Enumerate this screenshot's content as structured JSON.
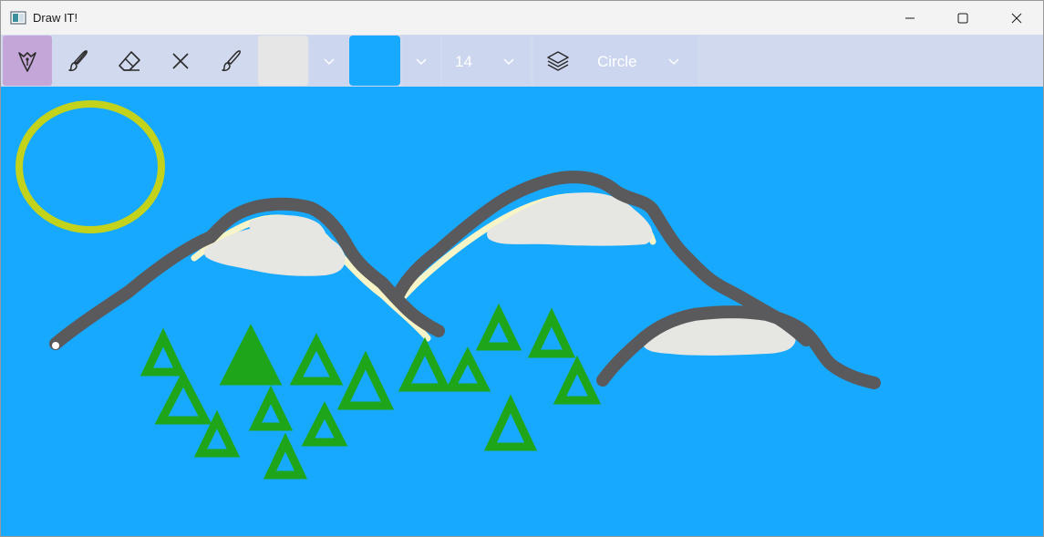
{
  "window": {
    "title": "Draw IT!"
  },
  "toolbar": {
    "stroke_color": "#e6e6e6",
    "fill_color": "#17a9fe",
    "stroke_size": "14",
    "shape": "Circle",
    "active_tool": "pen-tool"
  },
  "canvas": {
    "background_color": "#17a9fe",
    "stroke_color_mountains": "#5a5a5c",
    "cloud_color": "#e6e6e2",
    "tree_color": "#1fa51a",
    "sun_color": "#c3d31b"
  }
}
